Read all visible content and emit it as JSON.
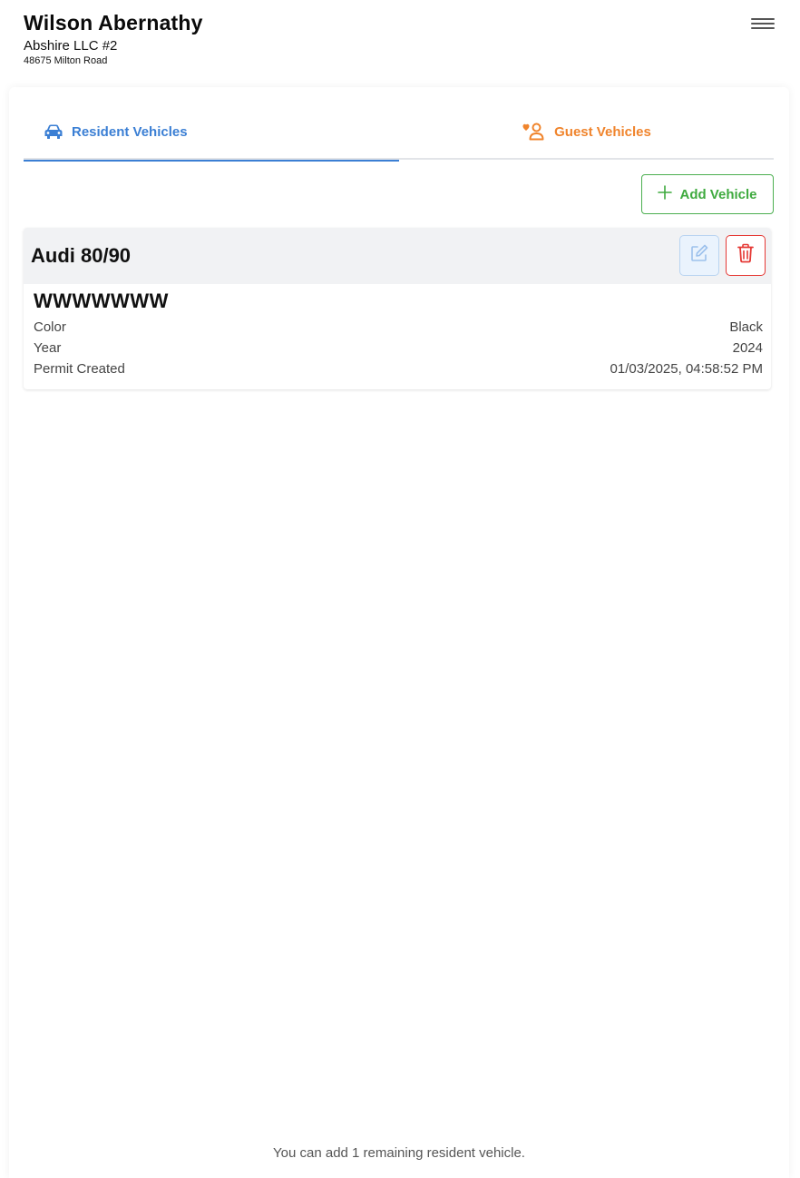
{
  "header": {
    "name": "Wilson Abernathy",
    "company": "Abshire LLC #2",
    "address": "48675 Milton Road",
    "menu_icon": "hamburger-menu-icon"
  },
  "tabs": [
    {
      "label": "Resident Vehicles",
      "icon": "car-icon",
      "active": true,
      "color": "#3b7fd4"
    },
    {
      "label": "Guest Vehicles",
      "icon": "guest-user-heart-icon",
      "active": false,
      "color": "#f0842c"
    }
  ],
  "actions": {
    "add_vehicle_label": "Add Vehicle",
    "add_icon": "plus-icon",
    "accent": "#4caf50"
  },
  "vehicles": [
    {
      "model": "Audi 80/90",
      "plate": "WWWWWWW",
      "fields": [
        {
          "label": "Color",
          "value": "Black"
        },
        {
          "label": "Year",
          "value": "2024"
        },
        {
          "label": "Permit Created",
          "value": "01/03/2025, 04:58:52 PM"
        }
      ]
    }
  ],
  "footer": {
    "remaining_text": "You can add 1 remaining resident vehicle."
  }
}
